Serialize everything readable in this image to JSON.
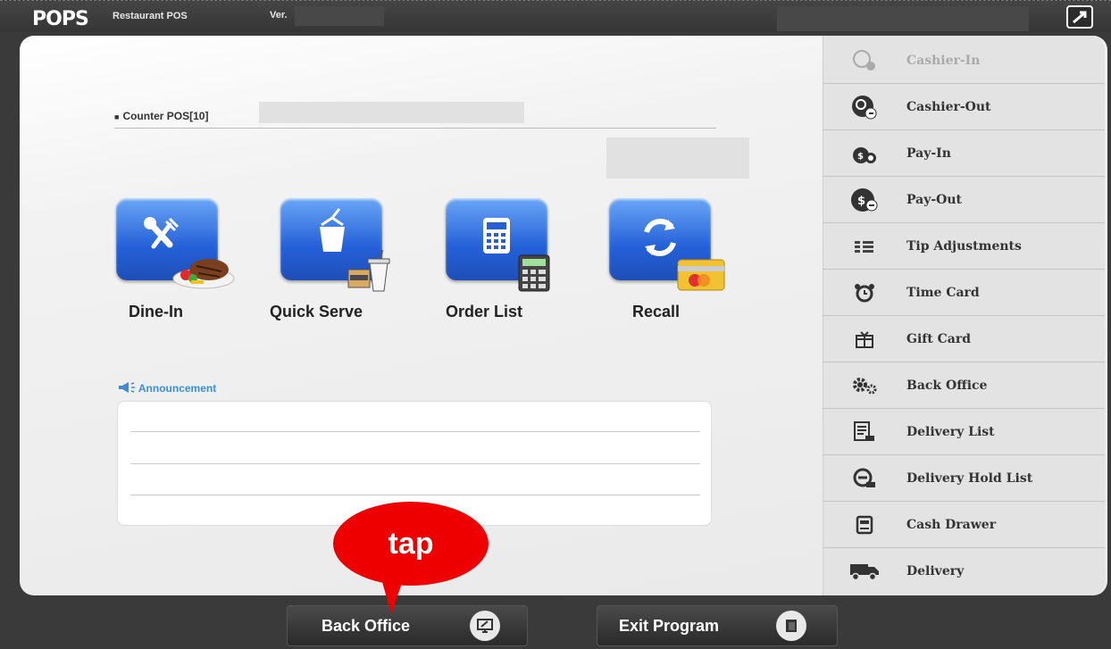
{
  "header": {
    "logo": "POPS",
    "logo_sub": "Restaurant POS",
    "version_label": "Ver."
  },
  "main": {
    "counter_label": "Counter POS[10]",
    "tiles": [
      {
        "label": "Dine-In",
        "icon": "fork-knife-steak-icon"
      },
      {
        "label": "Quick Serve",
        "icon": "takeout-cup-icon"
      },
      {
        "label": "Order List",
        "icon": "calculator-icon"
      },
      {
        "label": "Recall",
        "icon": "refresh-card-icon"
      }
    ],
    "announcement_label": "Announcement"
  },
  "sidebar": {
    "items": [
      {
        "label": "Cashier-In",
        "icon": "cashier-in-icon",
        "enabled": false
      },
      {
        "label": "Cashier-Out",
        "icon": "cashier-out-icon",
        "enabled": true
      },
      {
        "label": "Pay-In",
        "icon": "pay-in-icon",
        "enabled": true
      },
      {
        "label": "Pay-Out",
        "icon": "pay-out-icon",
        "enabled": true
      },
      {
        "label": "Tip Adjustments",
        "icon": "tip-list-icon",
        "enabled": true
      },
      {
        "label": "Time Card",
        "icon": "alarm-clock-icon",
        "enabled": true
      },
      {
        "label": "Gift Card",
        "icon": "gift-icon",
        "enabled": true
      },
      {
        "label": "Back Office",
        "icon": "gears-icon",
        "enabled": true
      },
      {
        "label": "Delivery List",
        "icon": "delivery-list-icon",
        "enabled": true
      },
      {
        "label": "Delivery Hold List",
        "icon": "delivery-hold-icon",
        "enabled": true
      },
      {
        "label": "Cash Drawer",
        "icon": "cash-drawer-icon",
        "enabled": true
      },
      {
        "label": "Delivery",
        "icon": "truck-icon",
        "enabled": true
      }
    ]
  },
  "bottom": {
    "back_office_label": "Back Office",
    "exit_label": "Exit Program"
  },
  "callout": {
    "text": "tap",
    "color": "#ee0000"
  }
}
